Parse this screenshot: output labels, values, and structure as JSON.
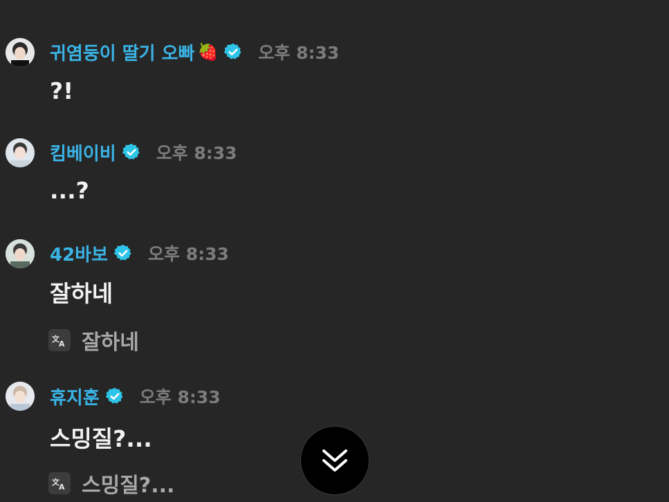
{
  "messages": [
    {
      "author": "귀염둥이 딸기 오빠",
      "emoji": "🍓",
      "time": "오후 8:33",
      "text": "?!",
      "avatar_icon": "user-avatar-1",
      "verified_badge_icon": "verified-badge-icon"
    },
    {
      "author": "킴베이비",
      "time": "오후 8:33",
      "text": "...?",
      "avatar_icon": "user-avatar-2",
      "verified_badge_icon": "verified-badge-icon"
    },
    {
      "author": "42바보",
      "time": "오후 8:33",
      "text": "잘하네",
      "translation": "잘하네",
      "translate_icon": "translate-icon",
      "avatar_icon": "user-avatar-3",
      "verified_badge_icon": "verified-badge-icon"
    },
    {
      "author": "휴지훈",
      "time": "오후 8:33",
      "text": "스밍질?...",
      "translation": "스밍질?...",
      "translate_icon": "translate-icon",
      "avatar_icon": "user-avatar-4",
      "verified_badge_icon": "verified-badge-icon"
    }
  ],
  "scroll_button": {
    "icon": "double-chevron-down-icon"
  },
  "colors": {
    "background": "#262626",
    "name": "#3ab4e6",
    "badge": "#2ec4e8",
    "time": "#7c7c7c",
    "text": "#f2f2f2",
    "translation": "#a9a9a9"
  }
}
